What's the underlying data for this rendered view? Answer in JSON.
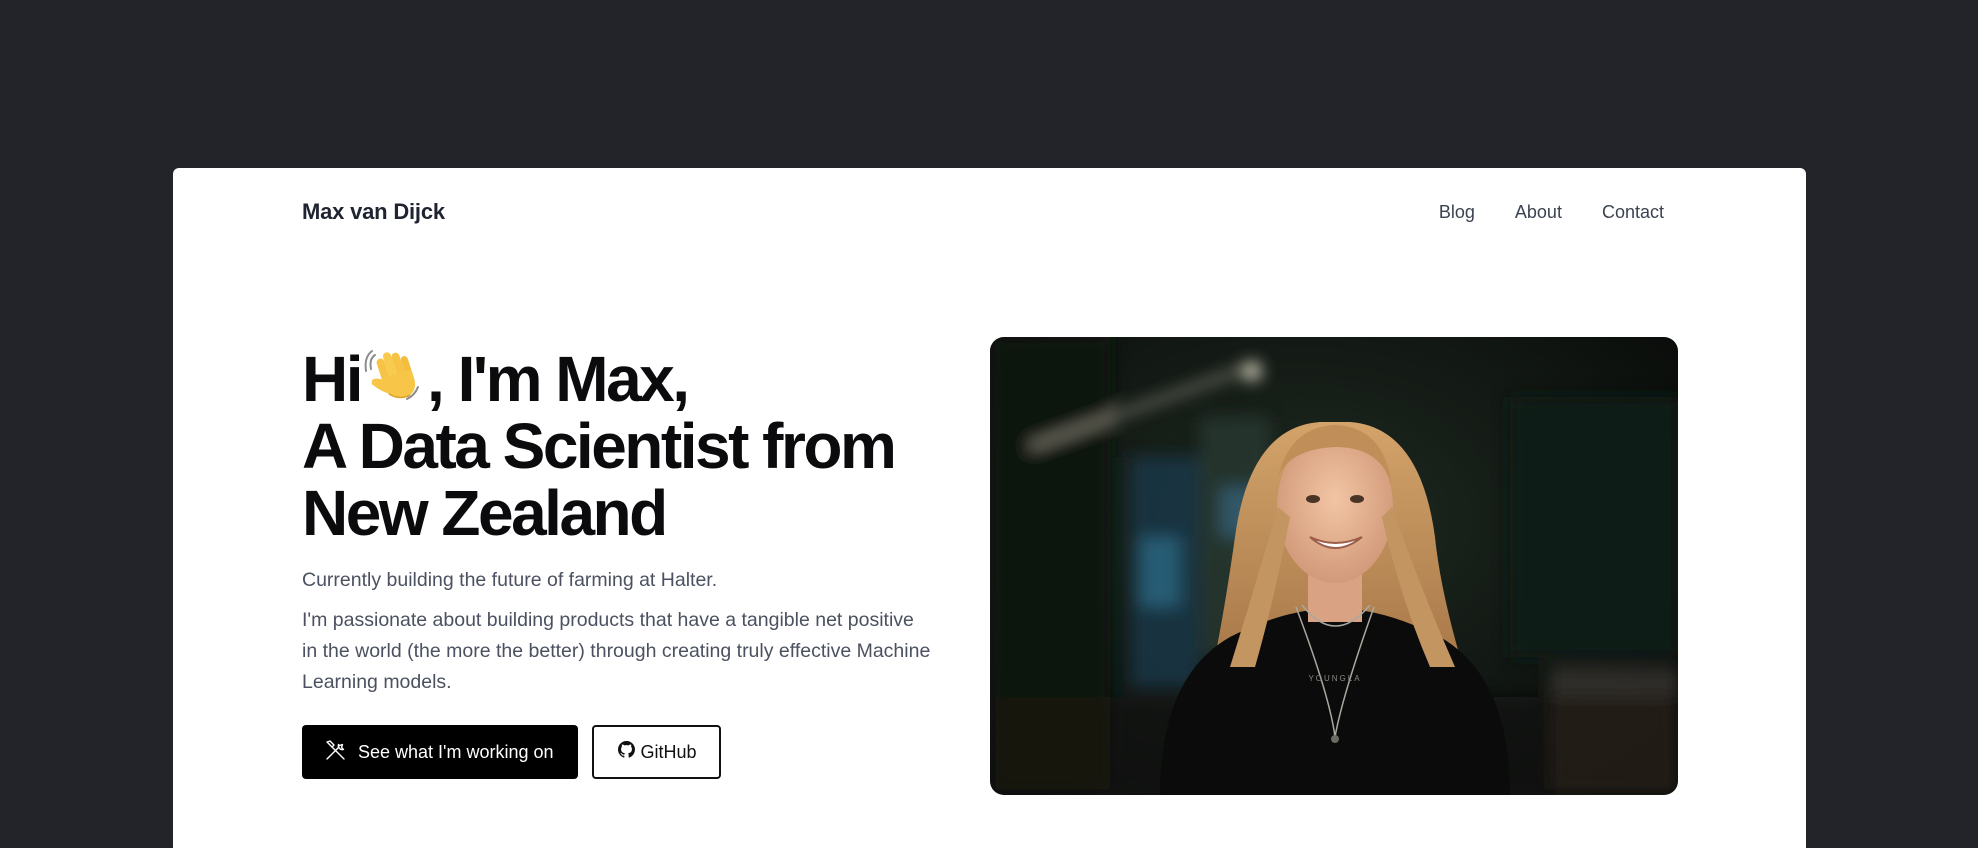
{
  "nav": {
    "brand": "Max van Dijck",
    "links": [
      {
        "label": "Blog"
      },
      {
        "label": "About"
      },
      {
        "label": "Contact"
      }
    ]
  },
  "hero": {
    "greeting_pre": "Hi",
    "greeting_post": ", I'm Max,",
    "wave_icon": "waving-hand-emoji",
    "headline_line2": "A Data Scientist from",
    "headline_line3": "New Zealand",
    "subline": "Currently building the future of farming at Halter.",
    "paragraph": "I'm passionate about building products that have a tangible net positive in the world (the more the better) through creating truly effective Machine Learning models.",
    "primary_button": {
      "label": "See what I'm working on",
      "icon": "tools-icon"
    },
    "secondary_button": {
      "label": "GitHub",
      "icon": "github-icon"
    }
  },
  "portrait": {
    "shirt_text": "YOUNGLA"
  },
  "colors": {
    "page_bg": "#232429",
    "card_bg": "#ffffff",
    "text_dark": "#0b0b0d",
    "text_muted": "#4b5160",
    "button_bg": "#000000"
  }
}
